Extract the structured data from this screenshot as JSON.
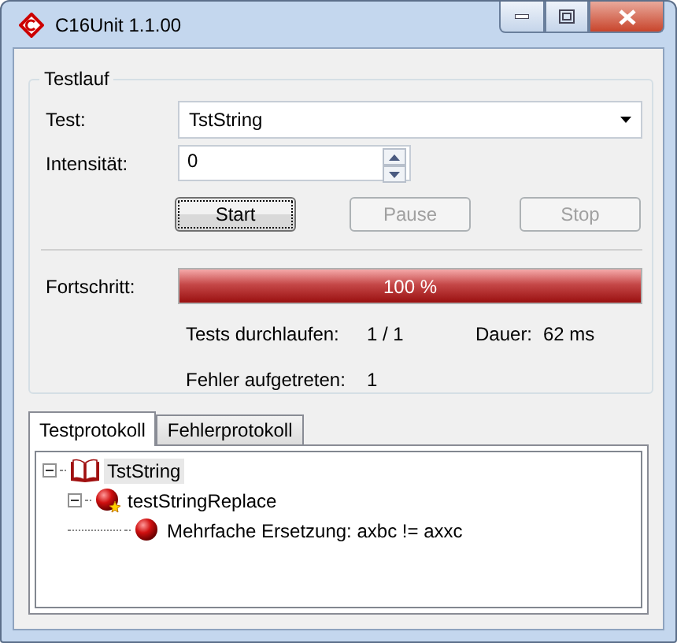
{
  "window": {
    "title": "C16Unit 1.1.00"
  },
  "testlauf": {
    "title": "Testlauf",
    "test": {
      "label": "Test:",
      "value": "TstString"
    },
    "intensity": {
      "label": "Intensität:",
      "value": "0"
    },
    "buttons": [
      {
        "label": "Start",
        "disabled": false,
        "focused": true
      },
      {
        "label": "Pause",
        "disabled": true,
        "focused": false
      },
      {
        "label": "Stop",
        "disabled": true,
        "focused": false
      }
    ],
    "progress": {
      "label": "Fortschritt:",
      "level": 1,
      "reading": "100 %"
    },
    "stats": {
      "passed_label": "Tests durchlaufen:",
      "passed": "1 / 1",
      "duration_label": "Dauer:",
      "duration": "62 ms",
      "errors_label": "Fehler aufgetreten:",
      "errors": "1"
    }
  },
  "tabs": [
    {
      "label": "Testprotokoll",
      "selected": true
    },
    {
      "label": "Fehlerprotokoll",
      "selected": false
    }
  ],
  "tree": [
    {
      "kind": "suite",
      "label": "TstString",
      "expanded": true,
      "selected": true,
      "children": [
        {
          "kind": "test",
          "label": "testStringReplace",
          "expanded": true,
          "selected": false,
          "children": [
            {
              "kind": "failure",
              "label": "Mehrfache Ersetzung: axbc != axxc",
              "selected": false
            }
          ]
        }
      ]
    }
  ]
}
